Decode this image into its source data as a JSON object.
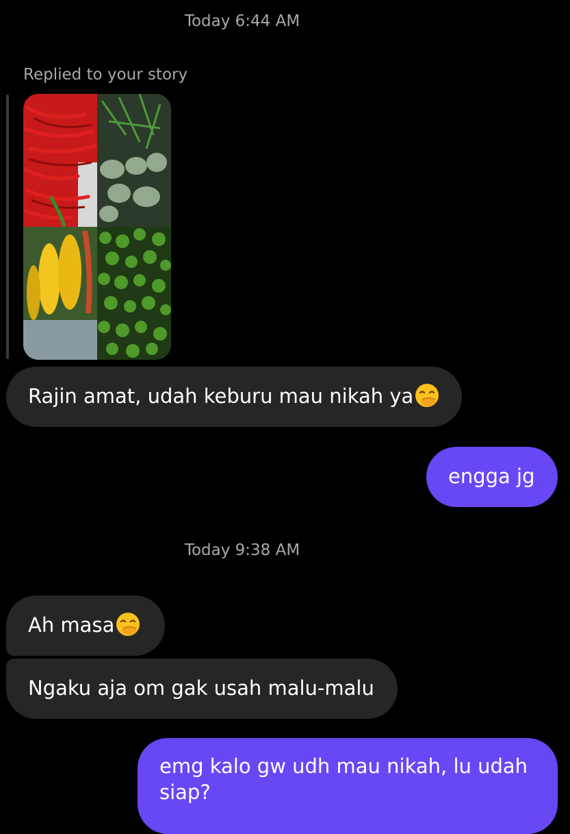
{
  "timestamps": [
    "Today 6:44 AM",
    "Today 9:38 AM"
  ],
  "story_reply": {
    "label": "Replied to your story",
    "image_icon": "story-collage-image"
  },
  "messages": [
    {
      "from": "them",
      "text": "Rajin amat, udah keburu mau nikah ya",
      "emoji": "face-with-hand-over-mouth"
    },
    {
      "from": "me",
      "text": "engga jg"
    },
    {
      "from": "them",
      "text": "Ah masa",
      "emoji": "face-with-hand-over-mouth"
    },
    {
      "from": "them",
      "text": "Ngaku aja om gak usah malu-malu"
    },
    {
      "from": "me",
      "text": "emg kalo gw udh mau nikah, lu udah siap?"
    }
  ],
  "colors": {
    "background": "#000000",
    "incoming_bubble": "#262626",
    "outgoing_bubble": "#6a47f5",
    "timestamp": "#a8a8a8"
  }
}
